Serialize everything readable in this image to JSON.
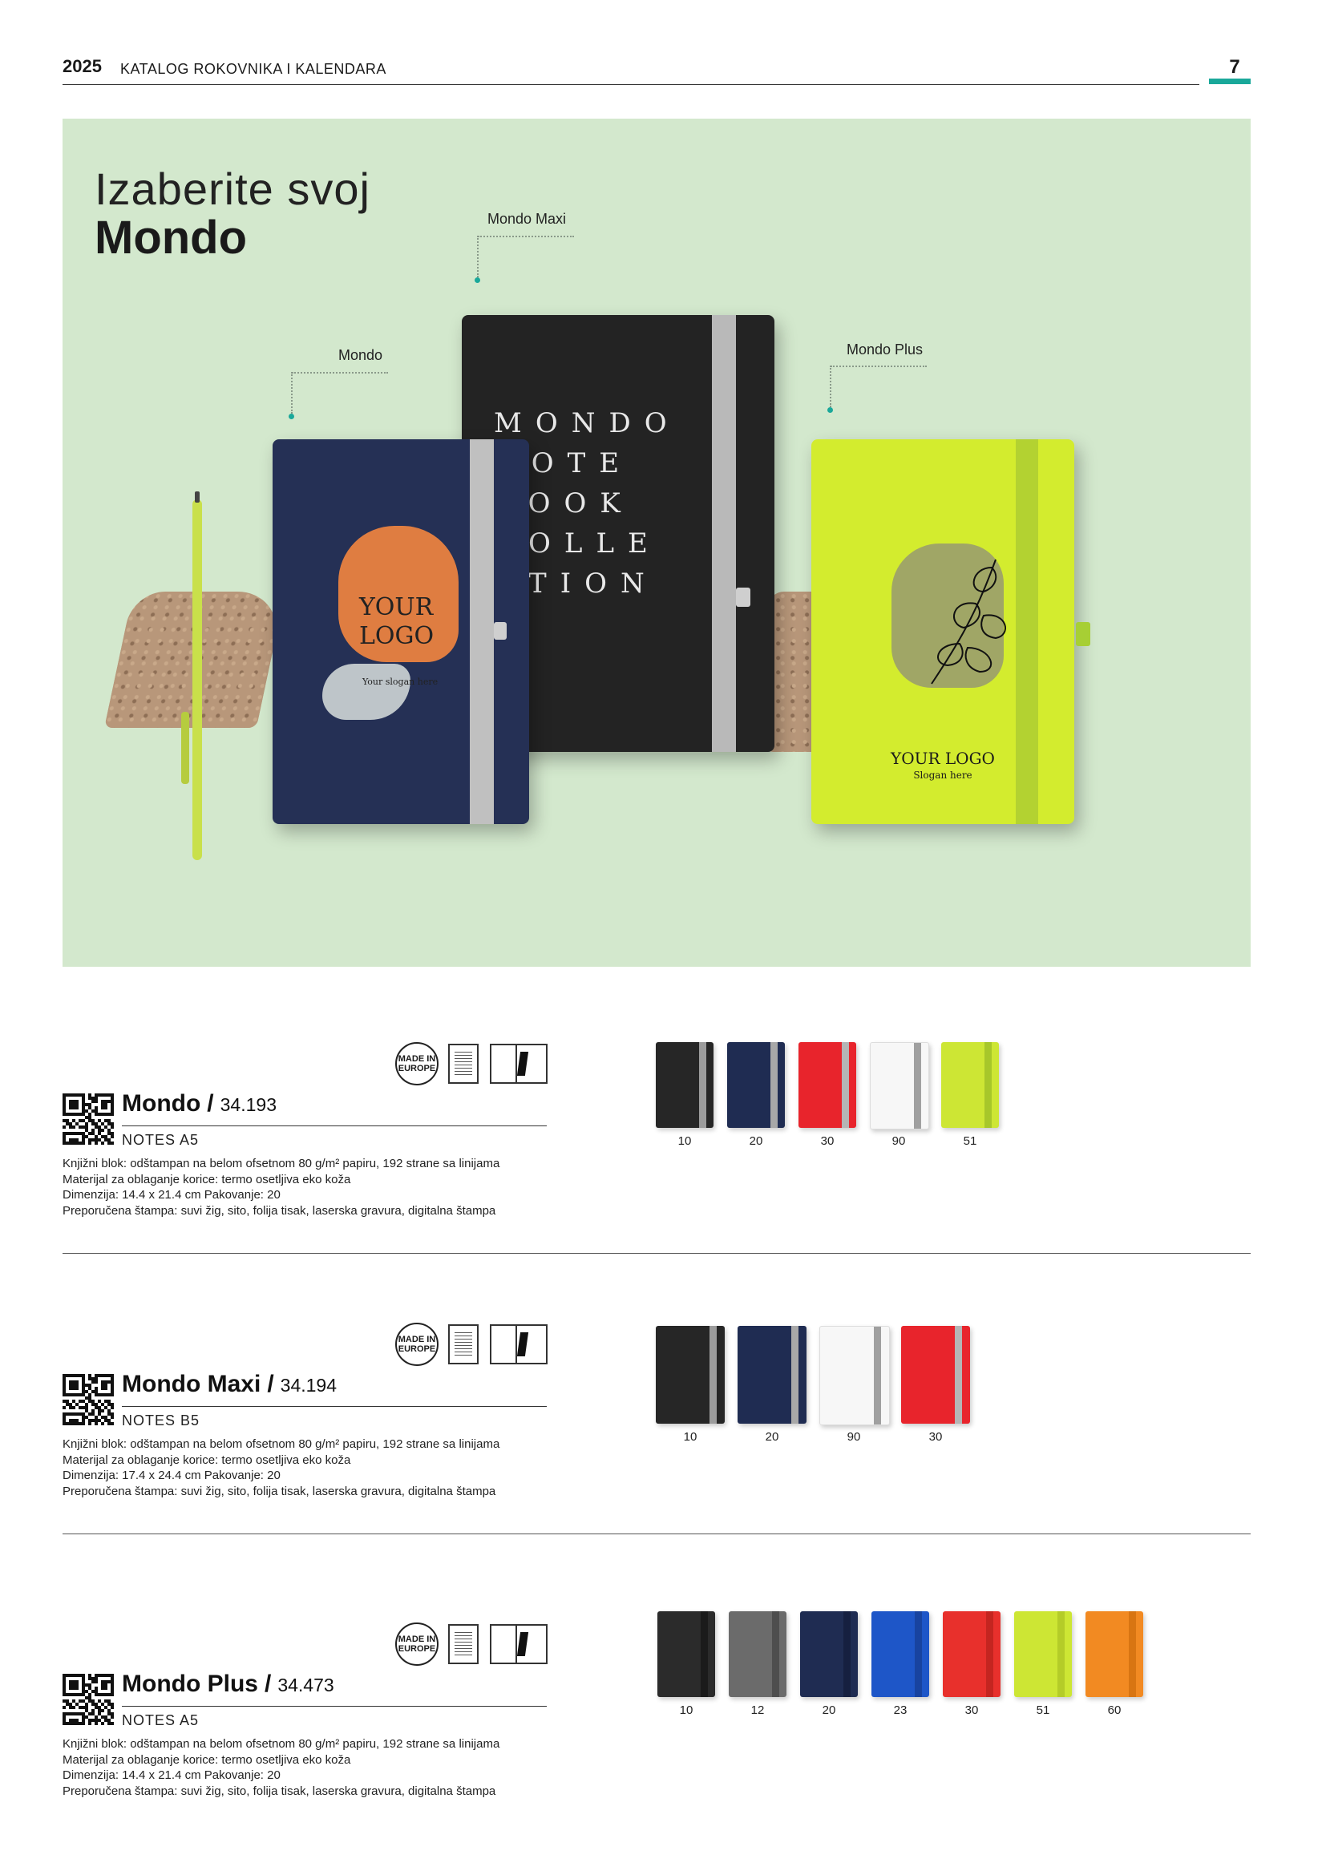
{
  "header": {
    "year": "2025",
    "title": "KATALOG ROKOVNIKA I KALENDARA",
    "page_number": "7",
    "accent_color": "#1aa89a"
  },
  "hero": {
    "title_line1": "Izaberite svoj",
    "title_line2": "Mondo",
    "background_color": "#d3e8cd",
    "callouts": {
      "mondo": "Mondo",
      "maxi": "Mondo Maxi",
      "plus": "Mondo Plus"
    },
    "mondo_notebook": {
      "logo_line1": "YOUR",
      "logo_line2": "LOGO",
      "slogan": "Your slogan here"
    },
    "maxi_notebook": {
      "lines": [
        "MONDO",
        "NOTE",
        "BOOK",
        "COLLE",
        "CTION"
      ]
    },
    "plus_notebook": {
      "logo": "YOUR LOGO",
      "slogan": "Slogan here"
    }
  },
  "badges": {
    "made_in_line1": "MADE IN",
    "made_in_line2": "EUROPE"
  },
  "products": [
    {
      "name": "Mondo",
      "separator": "/",
      "code": "34.193",
      "subtitle": "NOTES A5",
      "desc": [
        "Knjižni blok: odštampan na belom ofsetnom 80 g/m² papiru, 192 strane sa linijama",
        "Materijal za oblaganje korice: termo osetljiva eko koža",
        "Dimenzija: 14.4 x 21.4 cm Pakovanje: 20",
        "Preporučena štampa: suvi žig, sito, folija tisak, laserska gravura, digitalna štampa"
      ],
      "colors": [
        {
          "code": "10",
          "color": "#262626",
          "band": "#9c9c9c"
        },
        {
          "code": "20",
          "color": "#1f2c52",
          "band": "#a8a8a8"
        },
        {
          "code": "30",
          "color": "#e8242c",
          "band": "#b5b5b5"
        },
        {
          "code": "90",
          "color": "#f7f7f7",
          "band": "#a0a0a0"
        },
        {
          "code": "51",
          "color": "#cde634",
          "band": "#a7c72a"
        }
      ]
    },
    {
      "name": "Mondo Maxi",
      "separator": "/",
      "code": "34.194",
      "subtitle": "NOTES B5",
      "desc": [
        "Knjižni blok: odštampan na belom ofsetnom 80 g/m² papiru, 192 strane sa linijama",
        "Materijal za oblaganje korice: termo osetljiva eko koža",
        "Dimenzija: 17.4 x 24.4 cm Pakovanje: 20",
        "Preporučena štampa: suvi žig, sito, folija tisak, laserska gravura, digitalna štampa"
      ],
      "colors": [
        {
          "code": "10",
          "color": "#262626",
          "band": "#9c9c9c"
        },
        {
          "code": "20",
          "color": "#1f2c52",
          "band": "#a8a8a8"
        },
        {
          "code": "90",
          "color": "#f7f7f7",
          "band": "#a0a0a0"
        },
        {
          "code": "30",
          "color": "#e8242c",
          "band": "#b5b5b5"
        }
      ]
    },
    {
      "name": "Mondo Plus",
      "separator": "/",
      "code": "34.473",
      "subtitle": "NOTES A5",
      "desc": [
        "Knjižni blok: odštampan na belom ofsetnom 80 g/m² papiru, 192 strane sa linijama",
        "Materijal za oblaganje korice: termo osetljiva eko koža",
        "Dimenzija: 14.4 x 21.4 cm Pakovanje: 20",
        "Preporučena štampa: suvi žig, sito, folija tisak, laserska gravura, digitalna štampa"
      ],
      "colors": [
        {
          "code": "10",
          "color": "#2b2b2b",
          "band": "#1b1b1b"
        },
        {
          "code": "12",
          "color": "#6b6b6b",
          "band": "#4e4e4e"
        },
        {
          "code": "20",
          "color": "#1f2c52",
          "band": "#162040"
        },
        {
          "code": "23",
          "color": "#1e56c8",
          "band": "#1843a0"
        },
        {
          "code": "30",
          "color": "#e8302c",
          "band": "#c42520"
        },
        {
          "code": "51",
          "color": "#cde634",
          "band": "#b4cc28"
        },
        {
          "code": "60",
          "color": "#f28a22",
          "band": "#d87512"
        }
      ]
    }
  ]
}
